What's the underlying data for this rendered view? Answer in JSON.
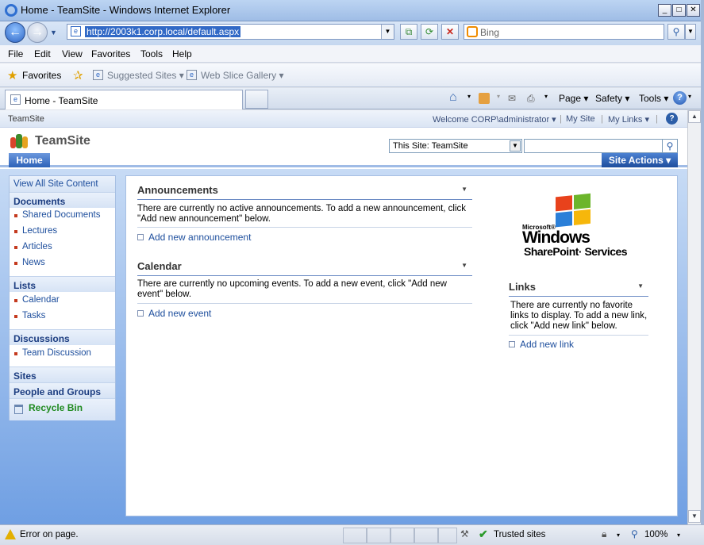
{
  "window": {
    "title": "Home - TeamSite - Windows Internet Explorer"
  },
  "address": {
    "url": "http://2003k1.corp.local/default.aspx"
  },
  "search_box": {
    "placeholder": "Bing"
  },
  "menubar": [
    "File",
    "Edit",
    "View",
    "Favorites",
    "Tools",
    "Help"
  ],
  "favbar": {
    "favorites": "Favorites",
    "suggested": "Suggested Sites",
    "webslice": "Web Slice Gallery"
  },
  "tab": {
    "label": "Home - TeamSite"
  },
  "commandbar": {
    "page": "Page",
    "safety": "Safety",
    "tools": "Tools"
  },
  "sp": {
    "breadcrumb": "TeamSite",
    "welcome": "Welcome CORP\\administrator",
    "mysite": "My Site",
    "mylinks": "My Links",
    "site_title": "TeamSite",
    "scope": "This Site: TeamSite",
    "home_tab": "Home",
    "site_actions": "Site Actions",
    "quicklaunch": {
      "view_all": "View All Site Content",
      "documents": "Documents",
      "doc_items": [
        "Shared Documents",
        "Lectures",
        "Articles",
        "News"
      ],
      "lists": "Lists",
      "list_items": [
        "Calendar",
        "Tasks"
      ],
      "discussions": "Discussions",
      "disc_items": [
        "Team Discussion"
      ],
      "sites": "Sites",
      "people": "People and Groups",
      "recycle": "Recycle Bin"
    },
    "announcements": {
      "title": "Announcements",
      "body": "There are currently no active announcements. To add a new announcement, click \"Add new announcement\" below.",
      "add": "Add new announcement"
    },
    "calendar": {
      "title": "Calendar",
      "body": "There are currently no upcoming events. To add a new event, click \"Add new event\" below.",
      "add": "Add new event"
    },
    "links": {
      "title": "Links",
      "body": "There are currently no favorite links to display. To add a new link, click \"Add new link\" below.",
      "add": "Add new link"
    },
    "logo": {
      "ms": "Microsoft®",
      "windows": "Windows",
      "sps": "SharePoint· Services"
    }
  },
  "statusbar": {
    "error": "Error on page.",
    "zone": "Trusted sites",
    "zoom": "100%"
  }
}
